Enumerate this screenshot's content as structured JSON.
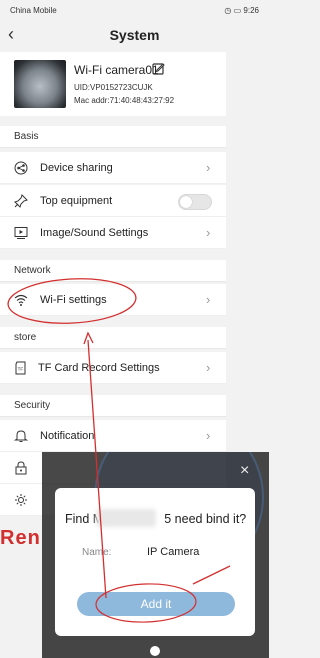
{
  "status_bar": {
    "carrier": "China Mobile",
    "time": "9:26"
  },
  "nav": {
    "back_icon": "‹",
    "title": "System"
  },
  "device": {
    "name": "Wi-Fi camera01",
    "uid": "UID:VP0152723CUJK",
    "mac": "Mac addr:71:40:48:43:27:92"
  },
  "sections": {
    "basis": {
      "title": "Basis",
      "device_sharing": "Device sharing",
      "top_equipment": "Top equipment",
      "top_equipment_on": false,
      "image_sound": "Image/Sound Settings"
    },
    "network": {
      "title": "Network",
      "wifi": "Wi-Fi settings"
    },
    "store": {
      "title": "store",
      "tf_card": "TF Card Record Settings"
    },
    "security": {
      "title": "Security",
      "notification": "Notification"
    }
  },
  "dialog": {
    "message_prefix": "Find MC",
    "message_suffix": "5 need bind it?",
    "name_label": "Name:",
    "name_value": "IP Camera",
    "add_button": "Add it",
    "close_icon": "×"
  },
  "annotation": {
    "text": "Ren",
    "color": "#d32f2f"
  },
  "colors": {
    "accent": "#8fb9dc",
    "annotation_red": "#d32f2f"
  }
}
